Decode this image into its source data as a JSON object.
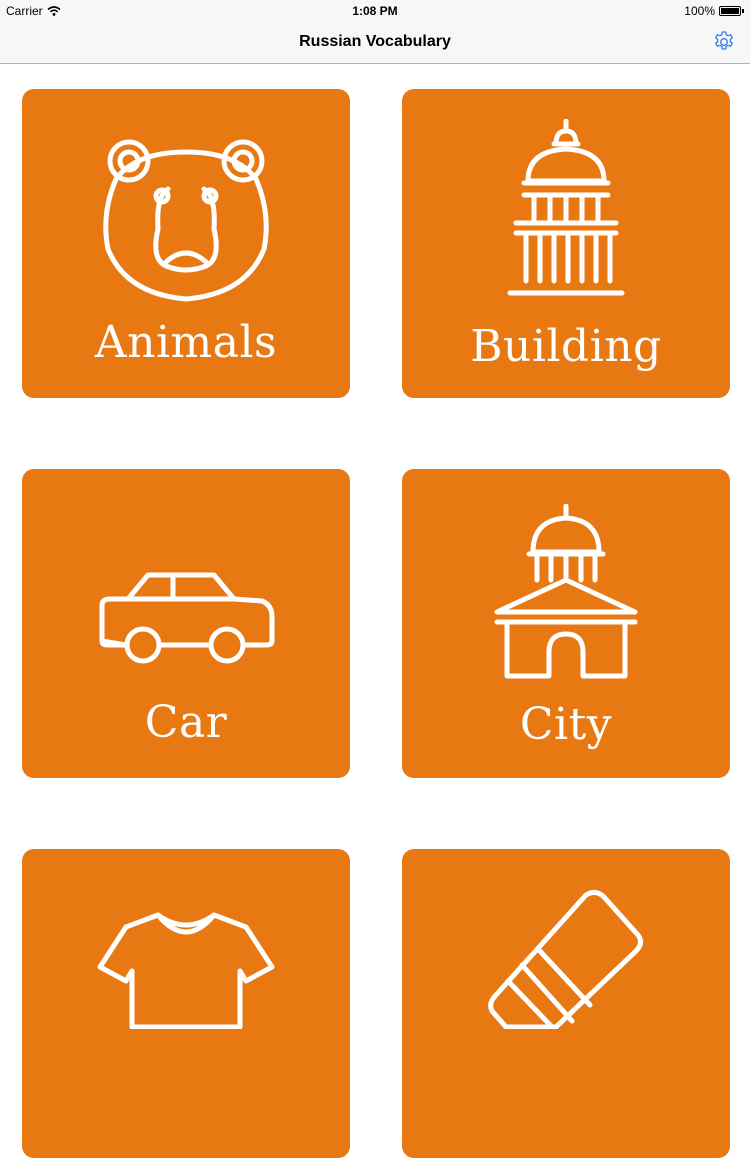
{
  "status_bar": {
    "carrier": "Carrier",
    "wifi_icon": "wifi-icon",
    "time": "1:08 PM",
    "battery": "100%",
    "battery_level": 1.0
  },
  "nav": {
    "title": "Russian Vocabulary",
    "settings_icon": "gear-icon"
  },
  "colors": {
    "tile": "#e87811",
    "accent": "#2f7cf6"
  },
  "categories": [
    {
      "label": "Animals",
      "icon": "bear-icon"
    },
    {
      "label": "Building",
      "icon": "capitol-building-icon"
    },
    {
      "label": "Car",
      "icon": "car-icon"
    },
    {
      "label": "City",
      "icon": "city-hall-icon"
    },
    {
      "label": "",
      "icon": "shirt-icon"
    },
    {
      "label": "",
      "icon": "eraser-icon"
    }
  ]
}
